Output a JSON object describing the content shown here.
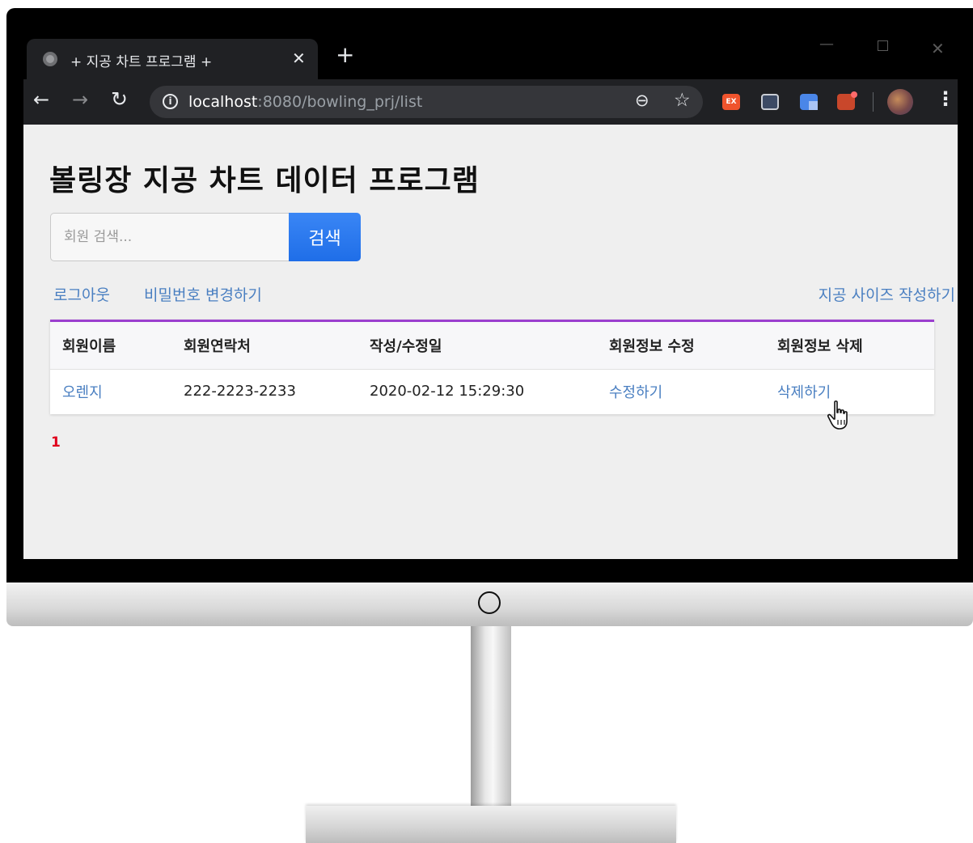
{
  "browser": {
    "tab_title": "+ 지공 차트 프로그램 +",
    "tab_close": "✕",
    "new_tab": "+",
    "url_host": "localhost",
    "url_rest": ":8080/bowling_prj/list",
    "ext_label": "EX"
  },
  "page": {
    "title": "볼링장 지공 차트 데이터 프로그램",
    "search": {
      "placeholder": "회원 검색...",
      "button_label": "검색"
    },
    "links": {
      "logout": "로그아웃",
      "change_password": "비밀번호 변경하기",
      "write_size": "지공 사이즈 작성하기"
    },
    "table": {
      "headers": [
        "회원이름",
        "회원연락처",
        "작성/수정일",
        "회원정보 수정",
        "회원정보 삭제"
      ],
      "rows": [
        {
          "name": "오렌지",
          "phone": "222-2223-2233",
          "date": "2020-02-12 15:29:30",
          "edit": "수정하기",
          "delete": "삭제하기"
        }
      ]
    },
    "pagination": {
      "current": "1"
    }
  },
  "colors": {
    "accent_blue": "#1f6ee8",
    "link_blue": "#4a7fc1",
    "table_top_border": "#9b3fcf",
    "page_number_red": "#e0001b"
  }
}
